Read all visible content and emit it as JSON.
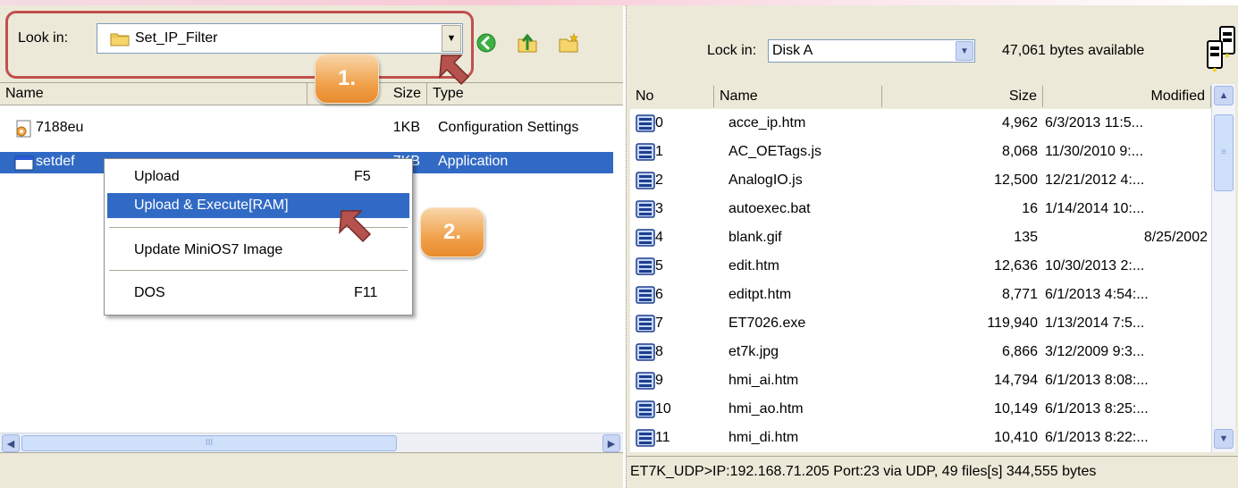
{
  "left": {
    "lookin_label": "Look in:",
    "lookin_value": "Set_IP_Filter",
    "columns": {
      "name": "Name",
      "size": "Size",
      "type": "Type"
    },
    "files": [
      {
        "name": "7188eu",
        "size": "1KB",
        "type": "Configuration Settings",
        "icon": "config-settings-icon"
      },
      {
        "name": "setdef",
        "size": "7KB",
        "type": "Application",
        "icon": "application-icon"
      }
    ],
    "scroll_grip": "III"
  },
  "context_menu": {
    "items": [
      {
        "label": "Upload",
        "key": "F5"
      },
      {
        "label": "Upload & Execute[RAM]",
        "key": ""
      },
      {
        "label": "Update MiniOS7 Image",
        "key": ""
      },
      {
        "label": "DOS",
        "key": "F11"
      }
    ]
  },
  "callouts": {
    "step1": "1.",
    "step2": "2."
  },
  "right": {
    "lockin_label": "Lock in:",
    "lockin_value": "Disk A",
    "available": "47,061 bytes available",
    "columns": {
      "no": "No",
      "name": "Name",
      "size": "Size",
      "modified": "Modified"
    },
    "files": [
      {
        "no": "0",
        "name": "acce_ip.htm",
        "size": "4,962",
        "modified": "6/3/2013 11:5..."
      },
      {
        "no": "1",
        "name": "AC_OETags.js",
        "size": "8,068",
        "modified": "11/30/2010 9:..."
      },
      {
        "no": "2",
        "name": "AnalogIO.js",
        "size": "12,500",
        "modified": "12/21/2012 4:..."
      },
      {
        "no": "3",
        "name": "autoexec.bat",
        "size": "16",
        "modified": "1/14/2014 10:..."
      },
      {
        "no": "4",
        "name": "blank.gif",
        "size": "135",
        "modified": "8/25/2002"
      },
      {
        "no": "5",
        "name": "edit.htm",
        "size": "12,636",
        "modified": "10/30/2013 2:..."
      },
      {
        "no": "6",
        "name": "editpt.htm",
        "size": "8,771",
        "modified": "6/1/2013 4:54:..."
      },
      {
        "no": "7",
        "name": "ET7026.exe",
        "size": "119,940",
        "modified": "1/13/2014 7:5..."
      },
      {
        "no": "8",
        "name": "et7k.jpg",
        "size": "6,866",
        "modified": "3/12/2009 9:3..."
      },
      {
        "no": "9",
        "name": "hmi_ai.htm",
        "size": "14,794",
        "modified": "6/1/2013 8:08:..."
      },
      {
        "no": "10",
        "name": "hmi_ao.htm",
        "size": "10,149",
        "modified": "6/1/2013 8:25:..."
      },
      {
        "no": "11",
        "name": "hmi_di.htm",
        "size": "10,410",
        "modified": "6/1/2013 8:22:..."
      }
    ],
    "status": "ET7K_UDP>IP:192.168.71.205 Port:23 via UDP, 49 files[s] 344,555 bytes"
  },
  "colors": {
    "selection": "#316ac5",
    "callout_border": "#c0504d",
    "badge": "#f0a24c",
    "arrow": "#b5524e"
  }
}
